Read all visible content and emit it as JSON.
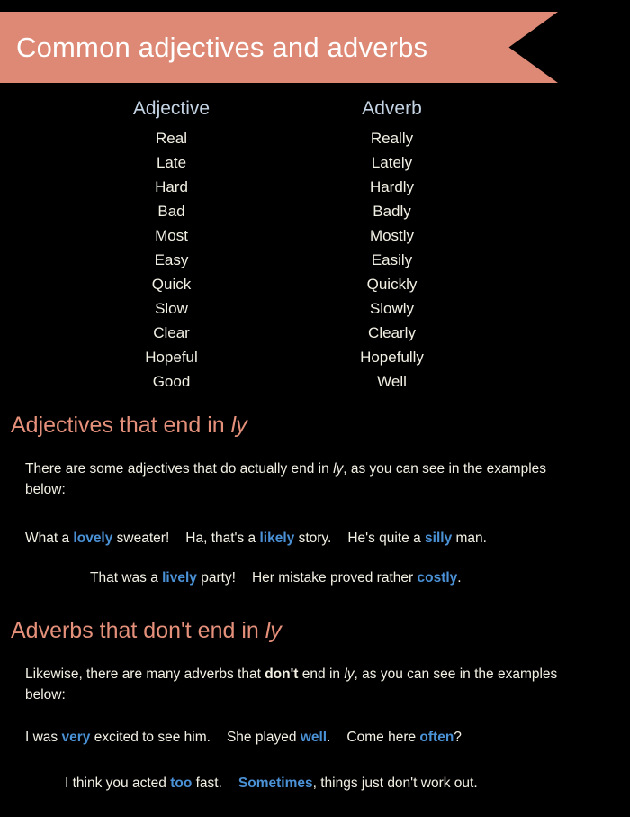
{
  "banner": {
    "title": "Common adjectives and adverbs",
    "color": "#dd8975",
    "text_color": "#ffffff"
  },
  "table": {
    "headers": [
      "Adjective",
      "Adverb"
    ],
    "header_color": "#c3d3e3",
    "text_color": "#f3f0e4",
    "rows": [
      [
        "Real",
        "Really"
      ],
      [
        "Late",
        "Lately"
      ],
      [
        "Hard",
        "Hardly"
      ],
      [
        "Bad",
        "Badly"
      ],
      [
        "Most",
        "Mostly"
      ],
      [
        "Easy",
        "Easily"
      ],
      [
        "Quick",
        "Quickly"
      ],
      [
        "Slow",
        "Slowly"
      ],
      [
        "Clear",
        "Clearly"
      ],
      [
        "Hopeful",
        "Hopefully"
      ],
      [
        "Good",
        "Well"
      ]
    ]
  },
  "section_adjectives": {
    "heading_plain": "Adjectives that end in ",
    "heading_italic": "ly",
    "heading_color": "#e4907a",
    "paragraph": {
      "part1": "There are some adjectives that do actually end in ",
      "italic": "ly",
      "part2": ", as you can see in the examples below:"
    },
    "examples_line1": [
      {
        "pre": "What a ",
        "highlight": "lovely",
        "post": " sweater!"
      },
      {
        "pre": "Ha, that's a ",
        "highlight": "likely",
        "post": " story."
      },
      {
        "pre": "He's quite a ",
        "highlight": "silly",
        "post": " man."
      }
    ],
    "examples_line2": [
      {
        "pre": "That was a ",
        "highlight": "lively",
        "post": " party!"
      },
      {
        "pre": "Her mistake proved rather ",
        "highlight": "costly",
        "post": "."
      }
    ]
  },
  "section_adverbs": {
    "heading_plain": "Adverbs that don't end in ",
    "heading_italic": "ly",
    "heading_color": "#e4907a",
    "paragraph": {
      "part1": "Likewise, there are many adverbs that ",
      "bold": "don't",
      "part2": " end in ",
      "italic": "ly",
      "part3": ", as you can see in the examples below:"
    },
    "examples_line1": [
      {
        "pre": "I was ",
        "highlight": "very",
        "post": " excited to see him."
      },
      {
        "pre": "She played ",
        "highlight": "well",
        "post": "."
      },
      {
        "pre": "Come here ",
        "highlight": "often",
        "post": "?"
      }
    ],
    "examples_line2": [
      {
        "pre": "I think you acted ",
        "highlight": "too",
        "post": " fast."
      },
      {
        "pre": "",
        "highlight": "Sometimes",
        "post": ", things just don't work out."
      }
    ]
  },
  "highlight_color": "#4a91d6",
  "background_color": "#000000"
}
